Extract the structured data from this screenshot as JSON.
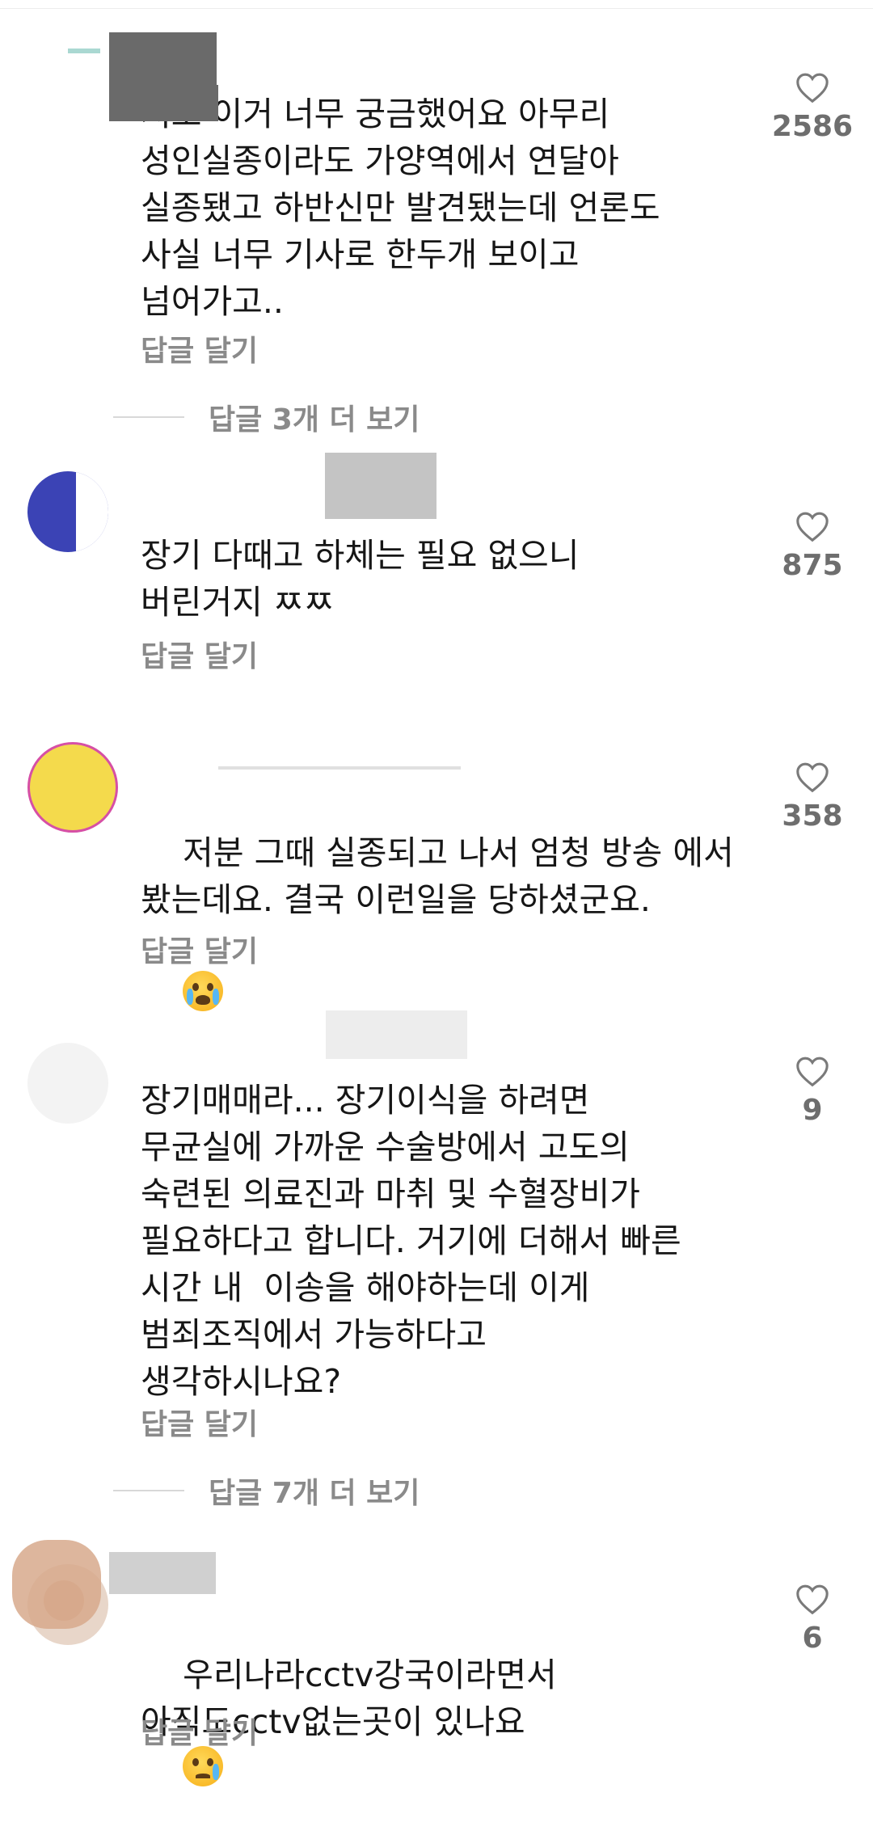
{
  "comments": [
    {
      "text": "저도 이거 너무 궁금했어요 아무리\n성인실종이라도 가양역에서 연달아\n실종됐고 하반신만 발견됐는데 언론도\n사실 너무 기사로 한두개 보이고\n넘어가고..",
      "reply_label": "답글 달기",
      "likes": "2586",
      "more_replies": "답글 3개 더 보기",
      "avatar_color": "#2a9d8f"
    },
    {
      "text": "장기 다때고 하체는 필요 없으니\n버린거지 ㅉㅉ",
      "reply_label": "답글 달기",
      "likes": "875",
      "avatar_color": "#3b43b5"
    },
    {
      "text": "저분 그때 실종되고 나서 엄청 방송 에서\n봤는데요. 결국 이런일을 당하셨군요.",
      "emoji": "crying-face",
      "reply_label": "답글 달기",
      "likes": "358",
      "avatar_color": "#f4da4c"
    },
    {
      "text": "장기매매라... 장기이식을 하려면\n무균실에 가까운 수술방에서 고도의\n숙련된 의료진과 마취 및 수혈장비가\n필요하다고 합니다. 거기에 더해서 빠른\n시간 내  이송을 해야하는데 이게\n범죄조직에서 가능하다고\n생각하시나요?",
      "reply_label": "답글 달기",
      "likes": "9",
      "more_replies": "답글 7개 더 보기",
      "avatar_color": "#e8e8e8"
    },
    {
      "text": "우리나라cctv강국이라면서\n아직도cctv없는곳이 있나요",
      "emoji": "sad-tear-face",
      "reply_label": "답글 달기",
      "likes": "6",
      "avatar_color": "#d7a98c"
    }
  ]
}
